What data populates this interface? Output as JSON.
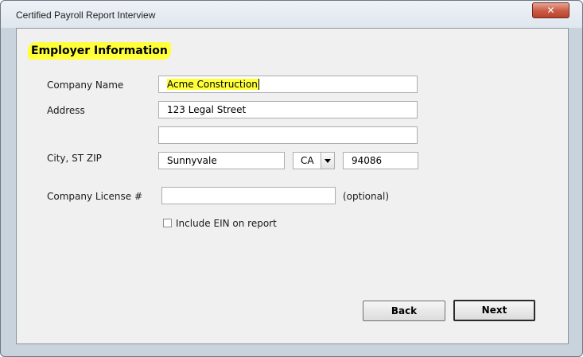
{
  "window": {
    "title": "Certified Payroll Report Interview",
    "close_label": "✕"
  },
  "form": {
    "heading": "Employer Information",
    "company_name": {
      "label": "Company Name",
      "value": "Acme Construction"
    },
    "address": {
      "label": "Address",
      "line1": "123 Legal Street",
      "line2": ""
    },
    "city_st_zip": {
      "label": "City, ST ZIP",
      "city": "Sunnyvale",
      "state": "CA",
      "zip": "94086"
    },
    "license": {
      "label": "Company License #",
      "value": "",
      "hint": "(optional)"
    },
    "include_ein": {
      "label": "Include EIN on report",
      "checked": false
    }
  },
  "buttons": {
    "back": "Back",
    "next": "Next"
  },
  "colors": {
    "highlight": "#ffff3a",
    "dialog_bg": "#f0f0f0",
    "frame": "#c9d3de",
    "close": "#c95a43"
  }
}
